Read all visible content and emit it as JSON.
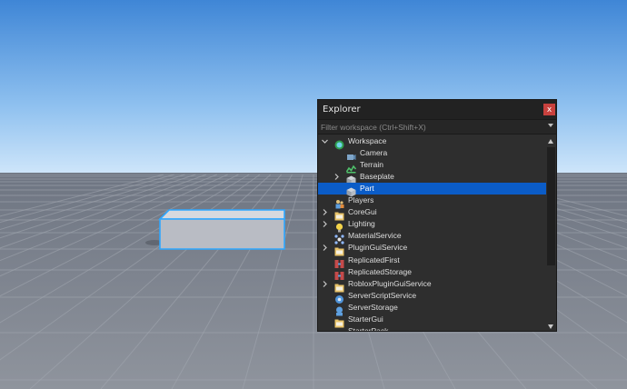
{
  "explorer": {
    "title": "Explorer",
    "close_label": "x",
    "filter_placeholder": "Filter workspace (Ctrl+Shift+X)",
    "items": [
      {
        "label": "Workspace",
        "icon": "workspace-globe-icon",
        "expander": "expanded"
      },
      {
        "label": "Camera",
        "icon": "camera-icon",
        "expander": "none"
      },
      {
        "label": "Terrain",
        "icon": "terrain-icon",
        "expander": "none"
      },
      {
        "label": "Baseplate",
        "icon": "part-cube-icon",
        "expander": "collapsed"
      },
      {
        "label": "Part",
        "icon": "part-cube-icon",
        "expander": "none",
        "selected": true
      },
      {
        "label": "Players",
        "icon": "players-icon",
        "expander": "none"
      },
      {
        "label": "CoreGui",
        "icon": "folder-gui-icon",
        "expander": "collapsed"
      },
      {
        "label": "Lighting",
        "icon": "lightbulb-icon",
        "expander": "collapsed"
      },
      {
        "label": "MaterialService",
        "icon": "material-service-icon",
        "expander": "none"
      },
      {
        "label": "PluginGuiService",
        "icon": "folder-gui-icon",
        "expander": "collapsed"
      },
      {
        "label": "ReplicatedFirst",
        "icon": "replicated-icon",
        "expander": "none"
      },
      {
        "label": "ReplicatedStorage",
        "icon": "replicated-icon",
        "expander": "none"
      },
      {
        "label": "RobloxPluginGuiService",
        "icon": "folder-gui-icon",
        "expander": "collapsed"
      },
      {
        "label": "ServerScriptService",
        "icon": "server-script-icon",
        "expander": "none"
      },
      {
        "label": "ServerStorage",
        "icon": "server-storage-icon",
        "expander": "none"
      },
      {
        "label": "StarterGui",
        "icon": "folder-gui-icon",
        "expander": "none"
      },
      {
        "label": "StarterPack",
        "icon": "starter-pack-icon",
        "expander": "none"
      }
    ]
  },
  "colors": {
    "selection": "#0b5cc7",
    "part_outline": "#2ea7ff",
    "panel_bg": "#2e2e2e",
    "titlebar_bg": "#222222",
    "close_bg": "#c8413e"
  }
}
